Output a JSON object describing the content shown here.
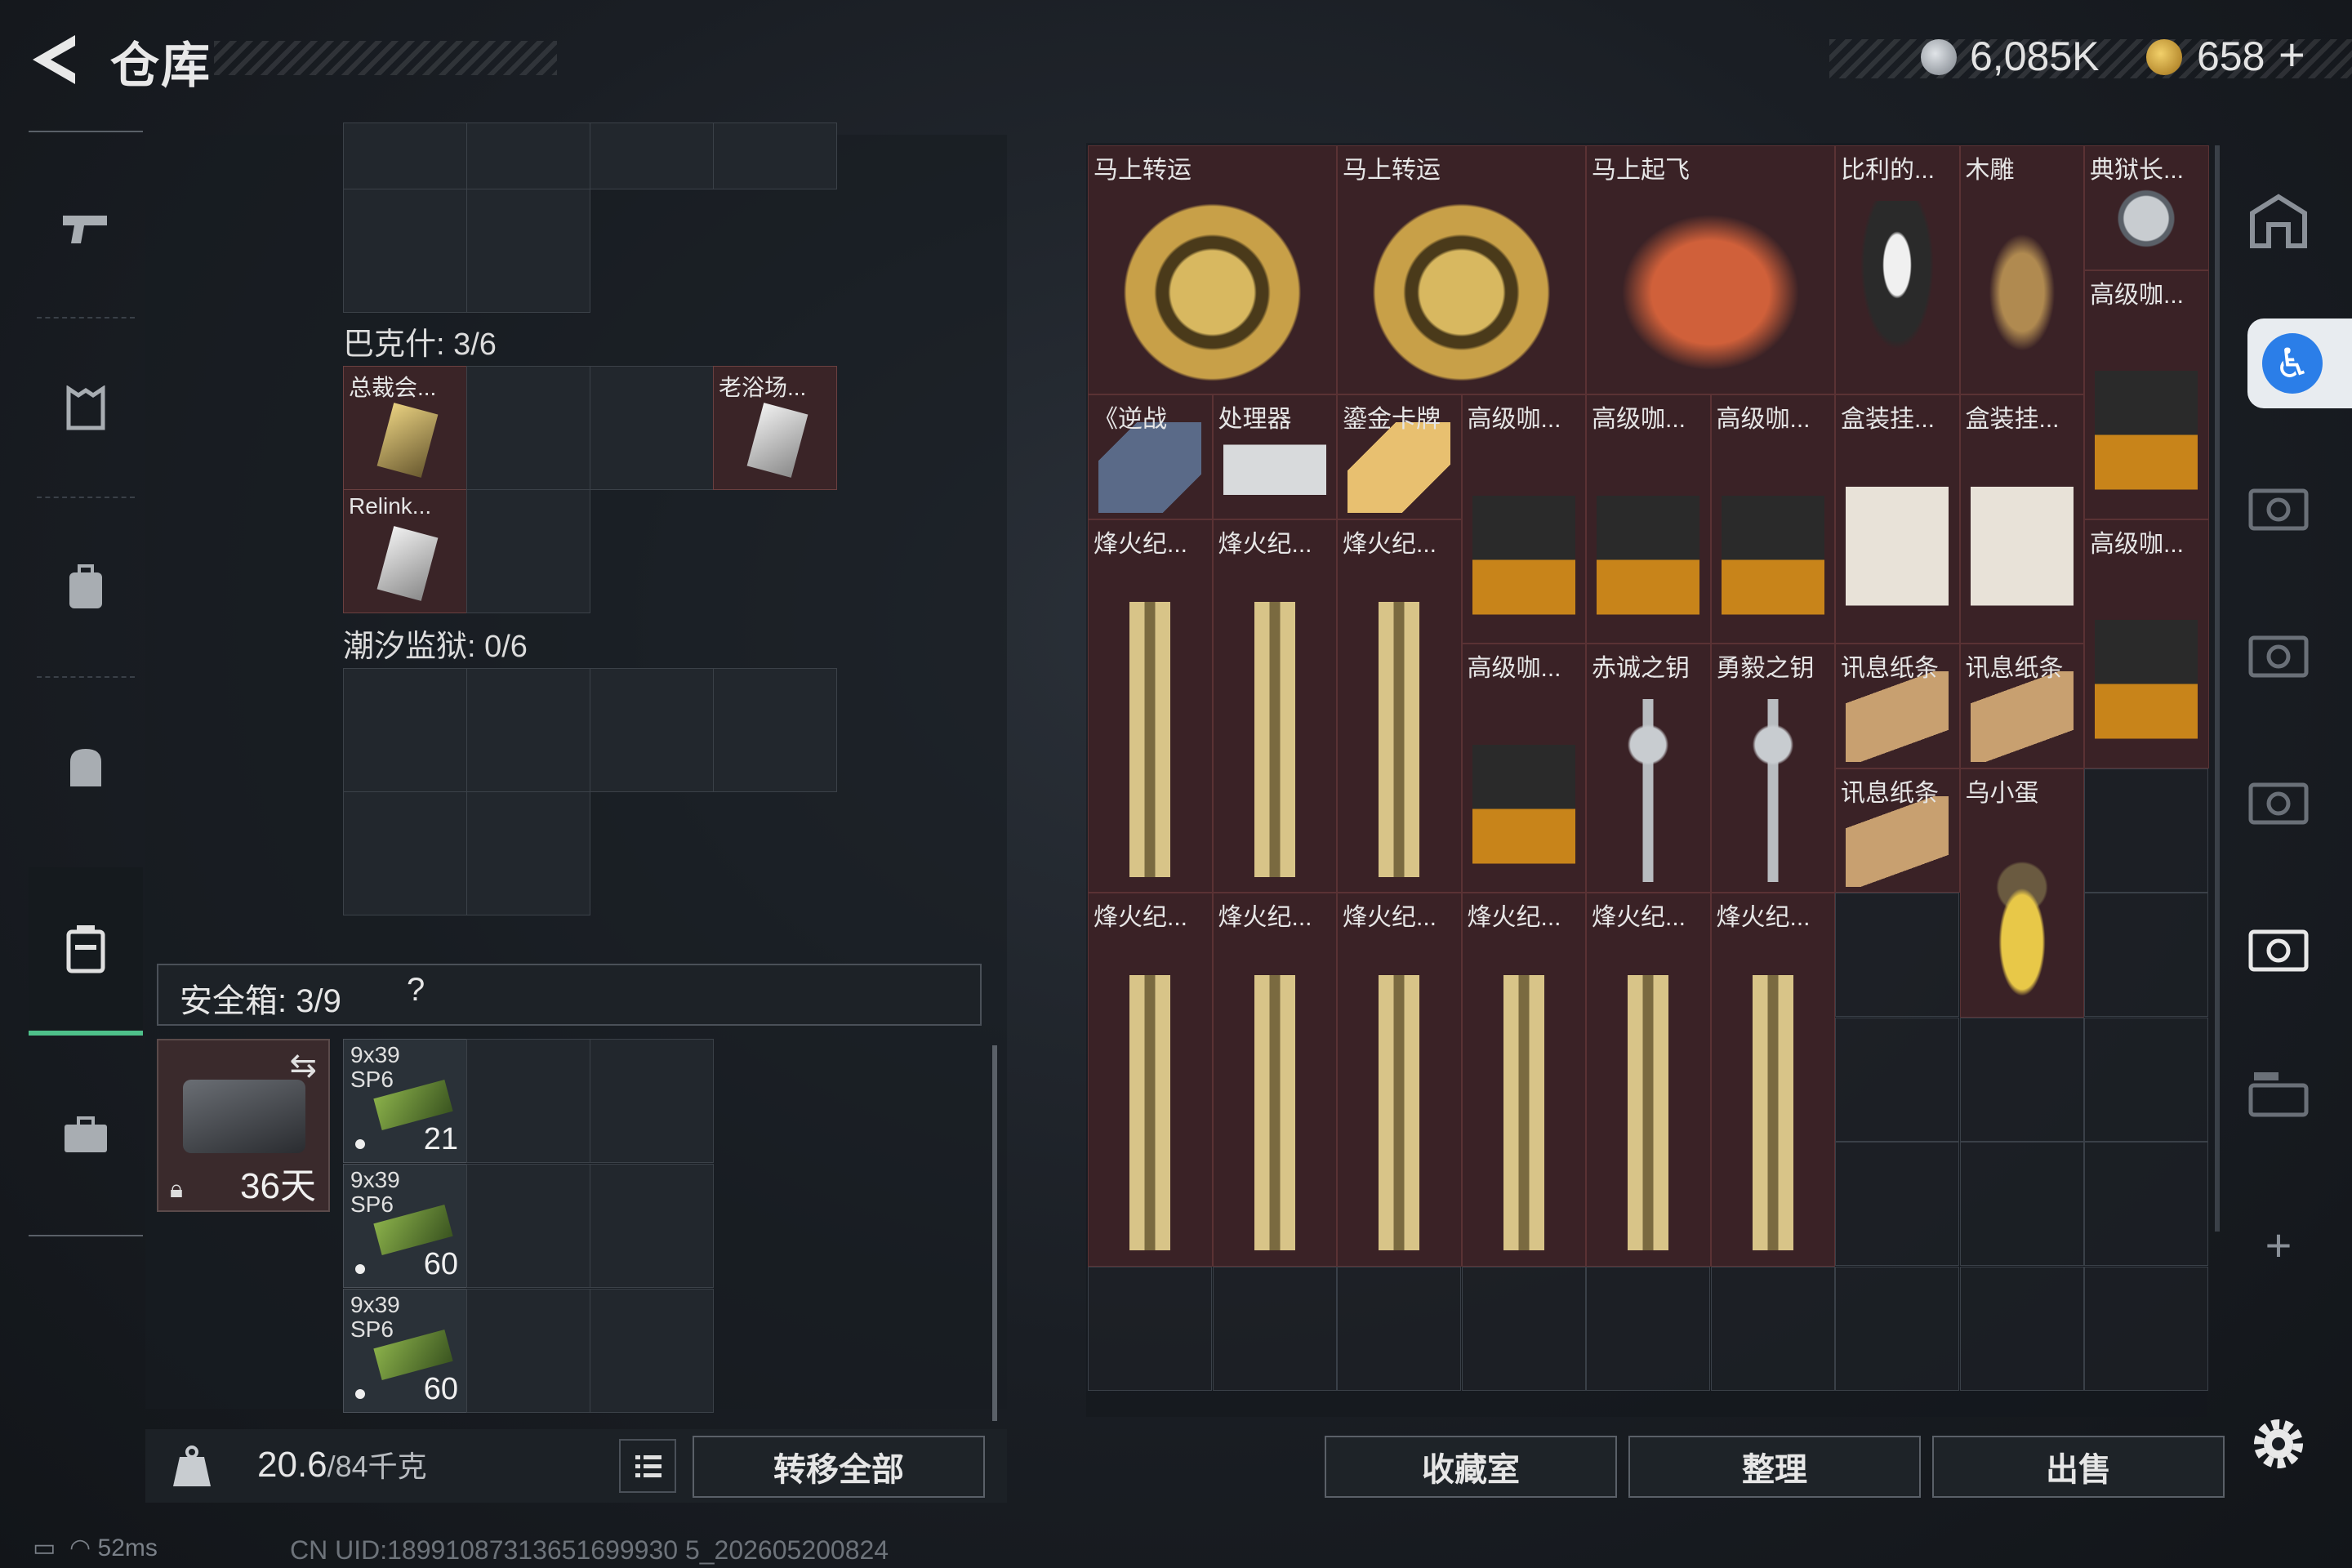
{
  "header": {
    "title": "仓库"
  },
  "currency": [
    {
      "name": "coins",
      "value": "6,085K",
      "color": "#c8ccd0"
    },
    {
      "name": "tokens",
      "value": "658",
      "plus": "+",
      "color": "#d4a52a"
    }
  ],
  "left_nav": {
    "icons": [
      "pistol-icon",
      "armor-vest-icon",
      "backpack-icon",
      "helmet-bag-icon",
      "stash-case-icon",
      "briefcase-icon"
    ],
    "active_index": 4
  },
  "sections": {
    "bakesh": {
      "label": "巴克什: 3/6"
    },
    "tide_prison": {
      "label": "潮汐监狱: 0/6"
    }
  },
  "left_items": [
    {
      "name": "总裁会..."
    },
    {
      "name": "老浴场..."
    },
    {
      "name": "Relink..."
    }
  ],
  "safe_box": {
    "label": "安全箱: 3/9",
    "help": "?",
    "duration": "36天"
  },
  "ammo": [
    {
      "name_line1": "9x39",
      "name_line2": "SP6",
      "count": "21"
    },
    {
      "name_line1": "9x39",
      "name_line2": "SP6",
      "count": "60"
    },
    {
      "name_line1": "9x39",
      "name_line2": "SP6",
      "count": "60"
    }
  ],
  "bottom": {
    "weight": "20.6",
    "weight_max": "/84千克",
    "transfer_all": "转移全部",
    "collection": "收藏室",
    "organize": "整理",
    "sell": "出售"
  },
  "stash_items": [
    "马上转运",
    "马上转运",
    "马上起飞",
    "比利的...",
    "木雕",
    "典狱长...",
    "高级咖...",
    "《逆战",
    "处理器",
    "鎏金卡牌",
    "高级咖...",
    "高级咖...",
    "高级咖...",
    "盒装挂...",
    "盒装挂...",
    "高级咖...",
    "烽火纪...",
    "烽火纪...",
    "烽火纪...",
    "高级咖...",
    "赤诚之钥",
    "勇毅之钥",
    "讯息纸条",
    "讯息纸条",
    "讯息纸条",
    "乌小蛋",
    "烽火纪...",
    "烽火纪...",
    "烽火纪...",
    "烽火纪...",
    "烽火纪...",
    "烽火纪..."
  ],
  "status": {
    "ping": "52ms",
    "uid": "CN UID:18991087313651699930 5_202605200824"
  }
}
